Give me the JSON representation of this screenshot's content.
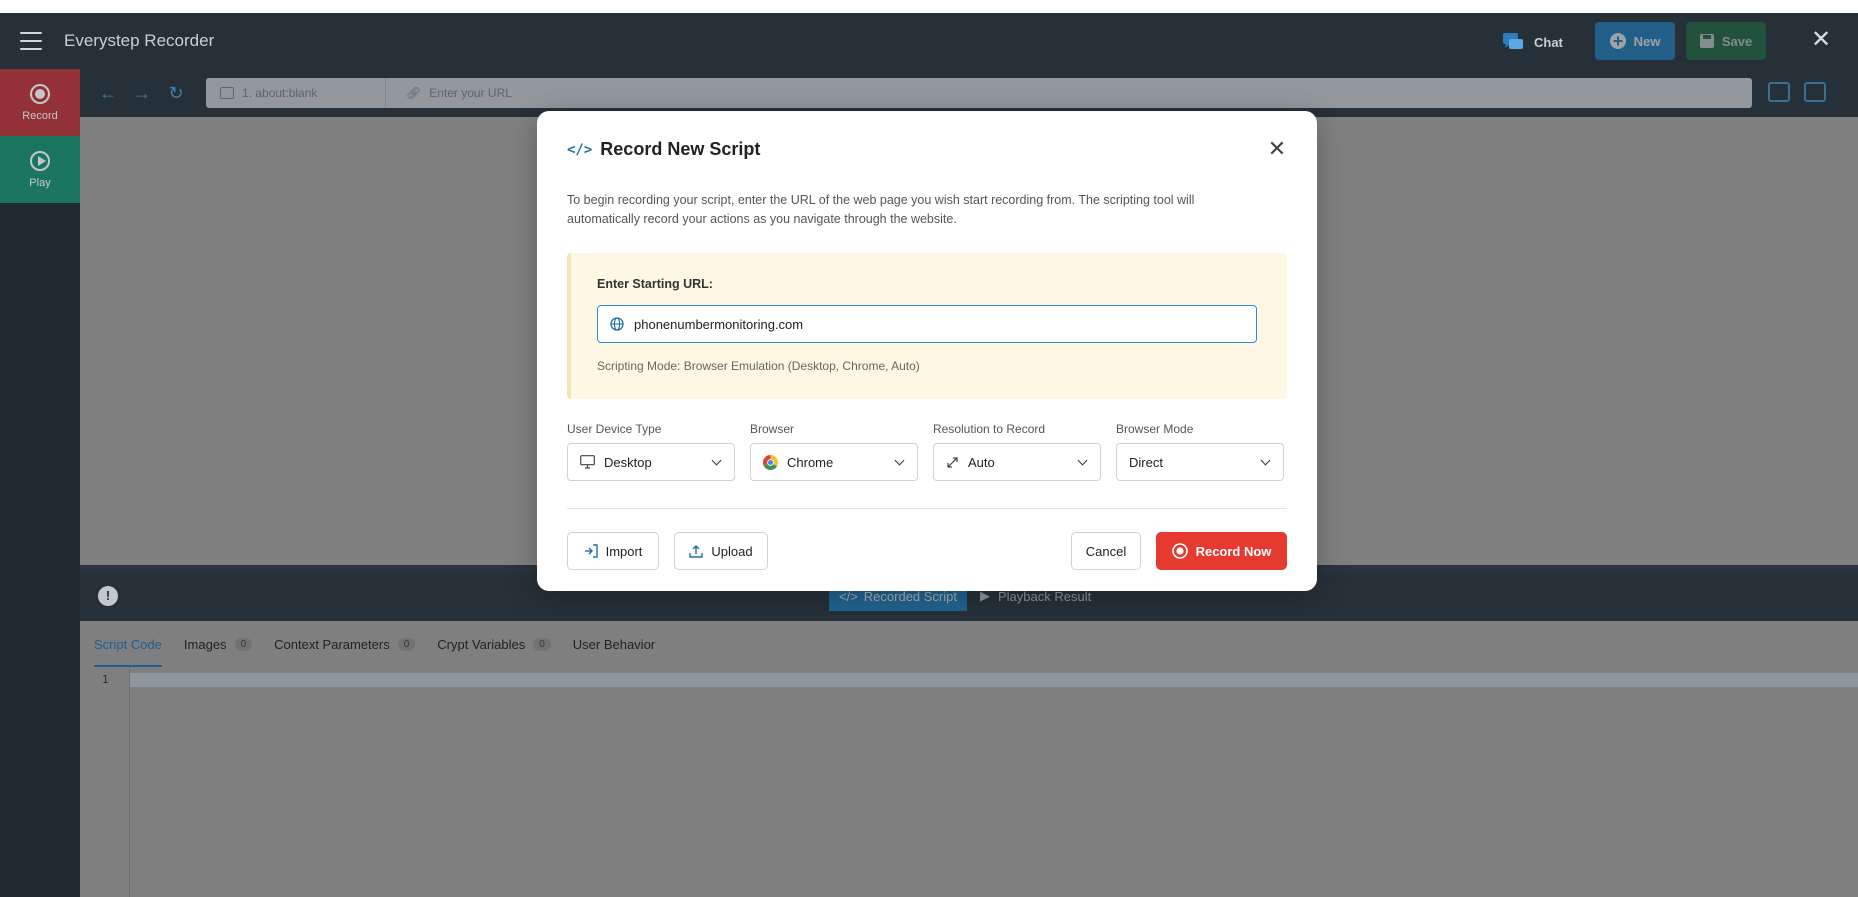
{
  "app": {
    "title": "Everystep Recorder",
    "chat_label": "Chat",
    "new_label": "New",
    "save_label": "Save"
  },
  "sidebar": {
    "items": [
      {
        "label": "Record",
        "icon": "record-icon"
      },
      {
        "label": "Play",
        "icon": "play-icon"
      }
    ]
  },
  "navbar": {
    "tab_label": "1. about:blank",
    "url_placeholder": "Enter your URL"
  },
  "panel": {
    "recorded_script_label": "Recorded Script",
    "playback_result_label": "Playback Result"
  },
  "code_tabs": [
    {
      "label": "Script Code",
      "count": null,
      "active": true
    },
    {
      "label": "Images",
      "count": "0"
    },
    {
      "label": "Context Parameters",
      "count": "0"
    },
    {
      "label": "Crypt Variables",
      "count": "0"
    },
    {
      "label": "User Behavior",
      "count": null
    }
  ],
  "editor": {
    "line_number": "1"
  },
  "modal": {
    "title": "Record New Script",
    "description": "To begin recording your script, enter the URL of the web page you wish start recording from. The scripting tool will automatically record your actions as you navigate through the website.",
    "url_label": "Enter Starting URL:",
    "url_value": "phonenumbermonitoring.com",
    "scripting_mode": "Scripting Mode: Browser Emulation (Desktop, Chrome, Auto)",
    "selects": {
      "device": {
        "label": "User Device Type",
        "value": "Desktop"
      },
      "browser": {
        "label": "Browser",
        "value": "Chrome"
      },
      "resolution": {
        "label": "Resolution to Record",
        "value": "Auto"
      },
      "mode": {
        "label": "Browser Mode",
        "value": "Direct"
      }
    },
    "import_label": "Import",
    "upload_label": "Upload",
    "cancel_label": "Cancel",
    "record_now_label": "Record Now"
  },
  "colors": {
    "accent": "#1f86c9",
    "record_red": "#e6392f",
    "play_green": "#1b8a6b",
    "url_box_bg": "#fef7e3"
  }
}
